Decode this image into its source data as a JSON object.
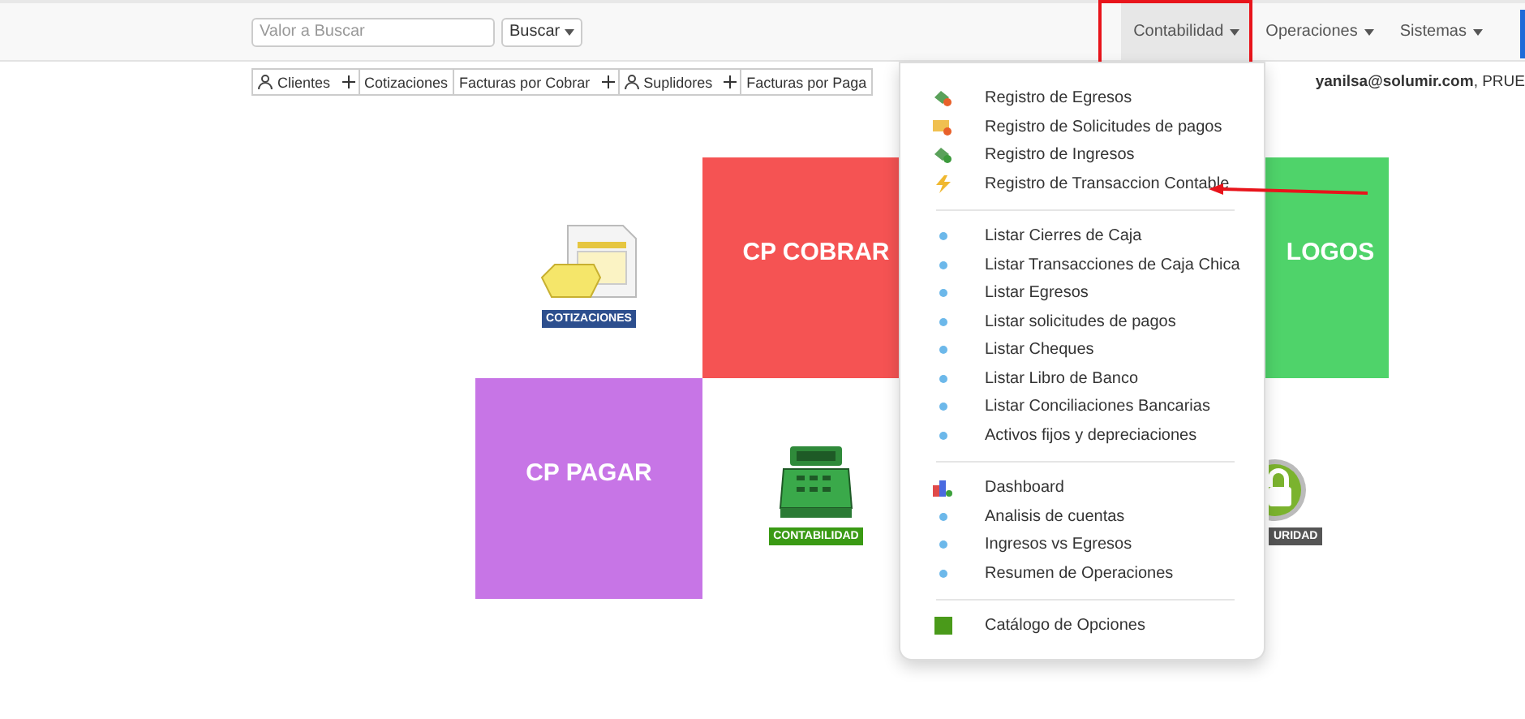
{
  "navbar": {
    "search": {
      "placeholder": "Valor a Buscar"
    },
    "search_button": "Buscar",
    "menus": [
      {
        "label": "Contabilidad",
        "selected": true
      },
      {
        "label": "Operaciones",
        "selected": false
      },
      {
        "label": "Sistemas",
        "selected": false
      }
    ]
  },
  "shortcuts": [
    {
      "label": "Clientes",
      "person": true,
      "add": true
    },
    {
      "label": "Cotizaciones",
      "person": false,
      "add": false
    },
    {
      "label": "Facturas por Cobrar",
      "person": false,
      "add": true
    },
    {
      "label": "Suplidores",
      "person": true,
      "add": true
    },
    {
      "label": "Facturas por Paga",
      "person": false,
      "add": false
    }
  ],
  "user": "**yanilsa@solumir.com**, PRUE",
  "tiles": [
    {
      "kind": "quotation",
      "label": "COTIZACIONES"
    },
    {
      "kind": "block",
      "label": "CP COBRAR",
      "color": "#f55353"
    },
    {
      "kind": "hidden"
    },
    {
      "kind": "block",
      "label": "LOGOS",
      "color": "#4fd36a"
    },
    {
      "kind": "block",
      "label": "CP PAGAR",
      "color": "#c775e6"
    },
    {
      "kind": "register",
      "label": "CONTABILIDAD"
    },
    {
      "kind": "hidden"
    },
    {
      "kind": "lock",
      "label": "URIDAD"
    }
  ],
  "dropdown": {
    "groups": [
      [
        {
          "label": "Registro de Egresos",
          "kind": "egress"
        },
        {
          "label": "Registro de Solicitudes de pagos",
          "kind": "request"
        },
        {
          "label": "Registro de Ingresos",
          "kind": "income"
        },
        {
          "label": "Registro de Transaccion Contable",
          "kind": "transaction"
        }
      ],
      [
        {
          "label": "Listar Cierres de Caja",
          "kind": "bullet"
        },
        {
          "label": "Listar Transacciones de Caja Chica",
          "kind": "bullet"
        },
        {
          "label": "Listar Egresos",
          "kind": "bullet"
        },
        {
          "label": "Listar solicitudes de pagos",
          "kind": "bullet"
        },
        {
          "label": "Listar Cheques",
          "kind": "bullet"
        },
        {
          "label": "Listar Libro de Banco",
          "kind": "bullet"
        },
        {
          "label": "Listar Conciliaciones Bancarias",
          "kind": "bullet"
        },
        {
          "label": "Activos fijos y depreciaciones",
          "kind": "bullet"
        }
      ],
      [
        {
          "label": "Dashboard",
          "kind": "chart"
        },
        {
          "label": "Analisis de cuentas",
          "kind": "bullet"
        },
        {
          "label": "Ingresos vs Egresos",
          "kind": "bullet"
        },
        {
          "label": "Resumen de Operaciones",
          "kind": "bullet"
        }
      ],
      [
        {
          "label": "Catálogo de Opciones",
          "kind": "catalog"
        }
      ]
    ]
  }
}
